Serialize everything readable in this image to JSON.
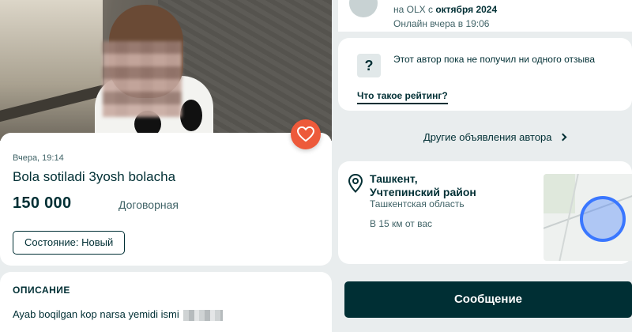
{
  "listing": {
    "posted": "Вчера, 19:14",
    "title": "Bola sotiladi 3yosh bolacha",
    "price": "150 000",
    "price_type": "Договорная",
    "condition": "Состояние: Новый",
    "favorite_icon": "heart-icon"
  },
  "description": {
    "heading": "ОПИСАНИЕ",
    "text": "Ayab boqilgan kop narsa yemidi ismi"
  },
  "seller": {
    "on_olx_prefix": "на OLX с ",
    "on_olx_date": "октября 2024",
    "last_online": "Онлайн вчера в 19:06"
  },
  "rating": {
    "icon": "?",
    "no_reviews": "Этот автор пока не получил ни одного отзыва",
    "what_is_rating": "Что такое рейтинг?"
  },
  "other_ads": {
    "label": "Другие объявления автора"
  },
  "location": {
    "city": "Ташкент,",
    "district": "Учтепинский район",
    "region": "Ташкентская область",
    "distance": "В 15 км от вас"
  },
  "actions": {
    "message": "Сообщение"
  },
  "colors": {
    "brand_dark": "#002f34",
    "heart_bg": "#ed5a3b",
    "map_circle": "#3a77ff"
  }
}
